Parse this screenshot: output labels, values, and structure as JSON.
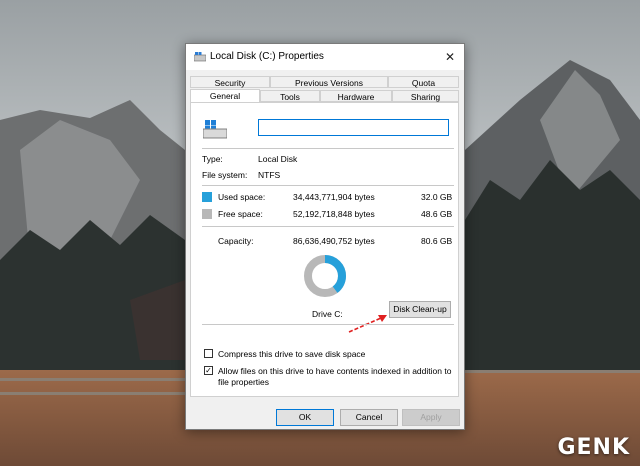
{
  "window": {
    "title": "Local Disk (C:) Properties",
    "close_glyph": "✕"
  },
  "tabs": {
    "row1": [
      "Security",
      "Previous Versions",
      "Quota"
    ],
    "row2": [
      "General",
      "Tools",
      "Hardware",
      "Sharing"
    ],
    "active": "General"
  },
  "general": {
    "name_value": "",
    "type_label": "Type:",
    "type_value": "Local Disk",
    "fs_label": "File system:",
    "fs_value": "NTFS",
    "used_label": "Used space:",
    "used_bytes": "34,443,771,904 bytes",
    "used_size": "32.0 GB",
    "free_label": "Free space:",
    "free_bytes": "52,192,718,848 bytes",
    "free_size": "48.6 GB",
    "capacity_label": "Capacity:",
    "capacity_bytes": "86,636,490,752 bytes",
    "capacity_size": "80.6 GB",
    "drive_label": "Drive C:",
    "cleanup_label": "Disk Clean-up",
    "compress_label": "Compress this drive to save disk space",
    "compress_checked": false,
    "index_label_line1": "Allow files on this drive to have contents indexed in addition to",
    "index_label_line2": "file properties",
    "index_checked": true,
    "used_fraction": 0.398
  },
  "buttons": {
    "ok": "OK",
    "cancel": "Cancel",
    "apply": "Apply"
  },
  "colors": {
    "used": "#26a0da",
    "free": "#b8b8b8",
    "annotation_arrow": "#e02020"
  },
  "watermark": "GENK"
}
